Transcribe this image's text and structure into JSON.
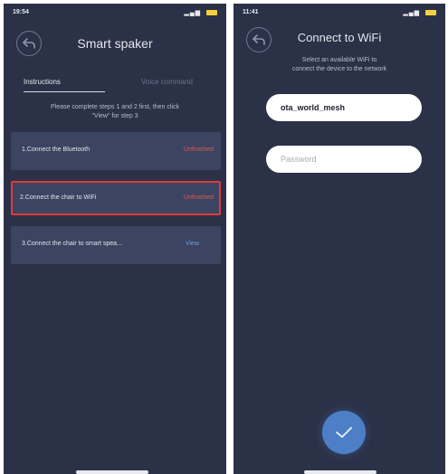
{
  "screens": {
    "left": {
      "status": {
        "time": "19:54"
      },
      "title": "Smart spaker",
      "tabs": [
        {
          "label": "Instructions",
          "active": true
        },
        {
          "label": "Voice command",
          "active": false
        }
      ],
      "note": "Please complete steps 1 and 2 first, then click\n\"View\" for step 3",
      "steps": [
        {
          "label": "1.Connect the Bluetooth",
          "status": "Unfinished"
        },
        {
          "label": "2.Connect the chair to WiFi",
          "status": "Unfinished",
          "highlighted": true
        },
        {
          "label": "3.Connect the chair to smart speа...",
          "status": "View"
        }
      ]
    },
    "right": {
      "status": {
        "time": "11:41"
      },
      "title": "Connect to WiFi",
      "subtitle": "Select an available WiFi to\nconnect the device to the network",
      "ssid_value": "ota_world_mesh",
      "password_placeholder": "Password"
    }
  },
  "colors": {
    "background": "#2b3147",
    "card": "#3b4460",
    "unfinished": "#d95a5a",
    "view": "#6fa0d8",
    "highlight": "#e03a3a",
    "confirm": "#4c7fc6"
  },
  "icons": {
    "back": "back-arrow-icon",
    "confirm": "checkmark-icon"
  }
}
